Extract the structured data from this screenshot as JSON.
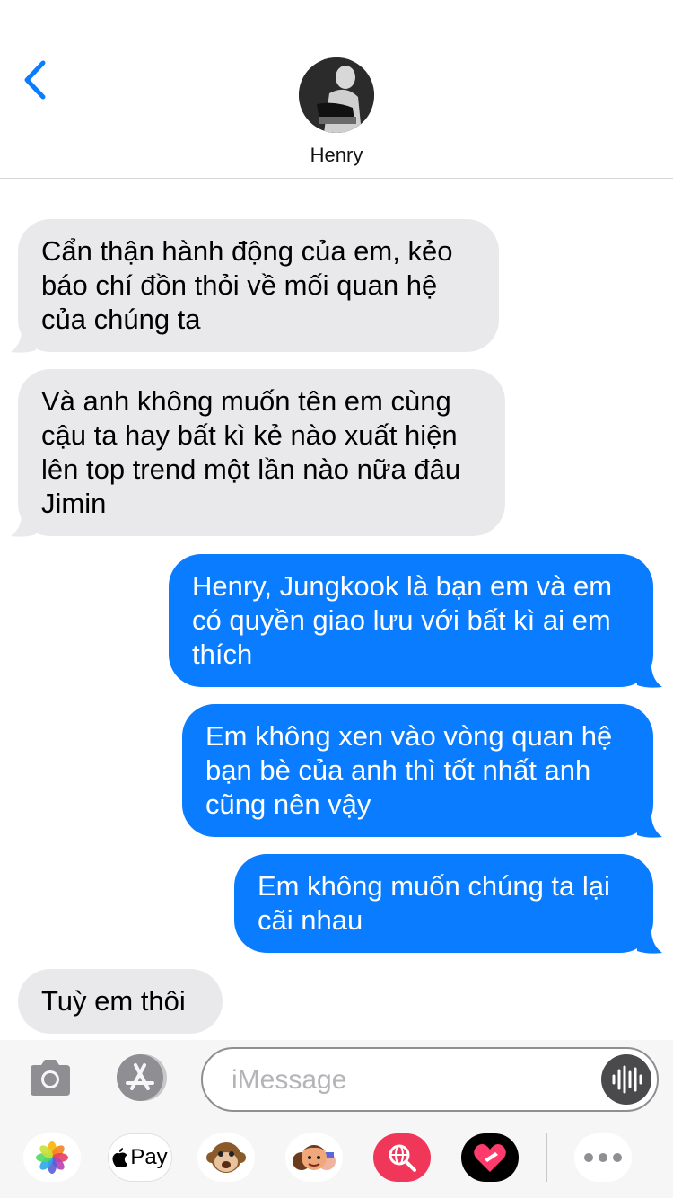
{
  "header": {
    "contact_name": "Henry",
    "back_icon": "chevron-left-icon"
  },
  "messages": [
    {
      "direction": "incoming",
      "text": "Cẩn thận hành động của em, kẻo báo chí đồn thỏi về mối quan hệ của chúng ta"
    },
    {
      "direction": "incoming",
      "text": "Và anh không muốn tên em cùng cậu ta hay bất kì kẻ nào xuất hiện lên top trend một lần nào nữa đâu Jimin"
    },
    {
      "direction": "outgoing",
      "text": "Henry, Jungkook là bạn em và em có quyền giao lưu với bất kì ai em thích"
    },
    {
      "direction": "outgoing",
      "text": "Em không xen vào vòng quan hệ bạn bè của anh thì tốt nhất anh cũng nên vậy"
    },
    {
      "direction": "outgoing",
      "text": "Em không muốn chúng ta lại cãi nhau"
    },
    {
      "direction": "incoming",
      "text": "Tuỳ em thôi"
    }
  ],
  "composer": {
    "placeholder": "iMessage",
    "value": ""
  },
  "app_strip": {
    "apps": [
      "photos-icon",
      "apple-pay-icon",
      "animoji-icon",
      "memoji-icon",
      "web-search-icon",
      "digital-touch-icon",
      "more-icon"
    ],
    "apple_pay_label": "Pay"
  },
  "colors": {
    "incoming_bubble": "#e9e9eb",
    "outgoing_bubble": "#0a7cff",
    "accent": "#0a7cff",
    "battery": "#4cd964"
  }
}
